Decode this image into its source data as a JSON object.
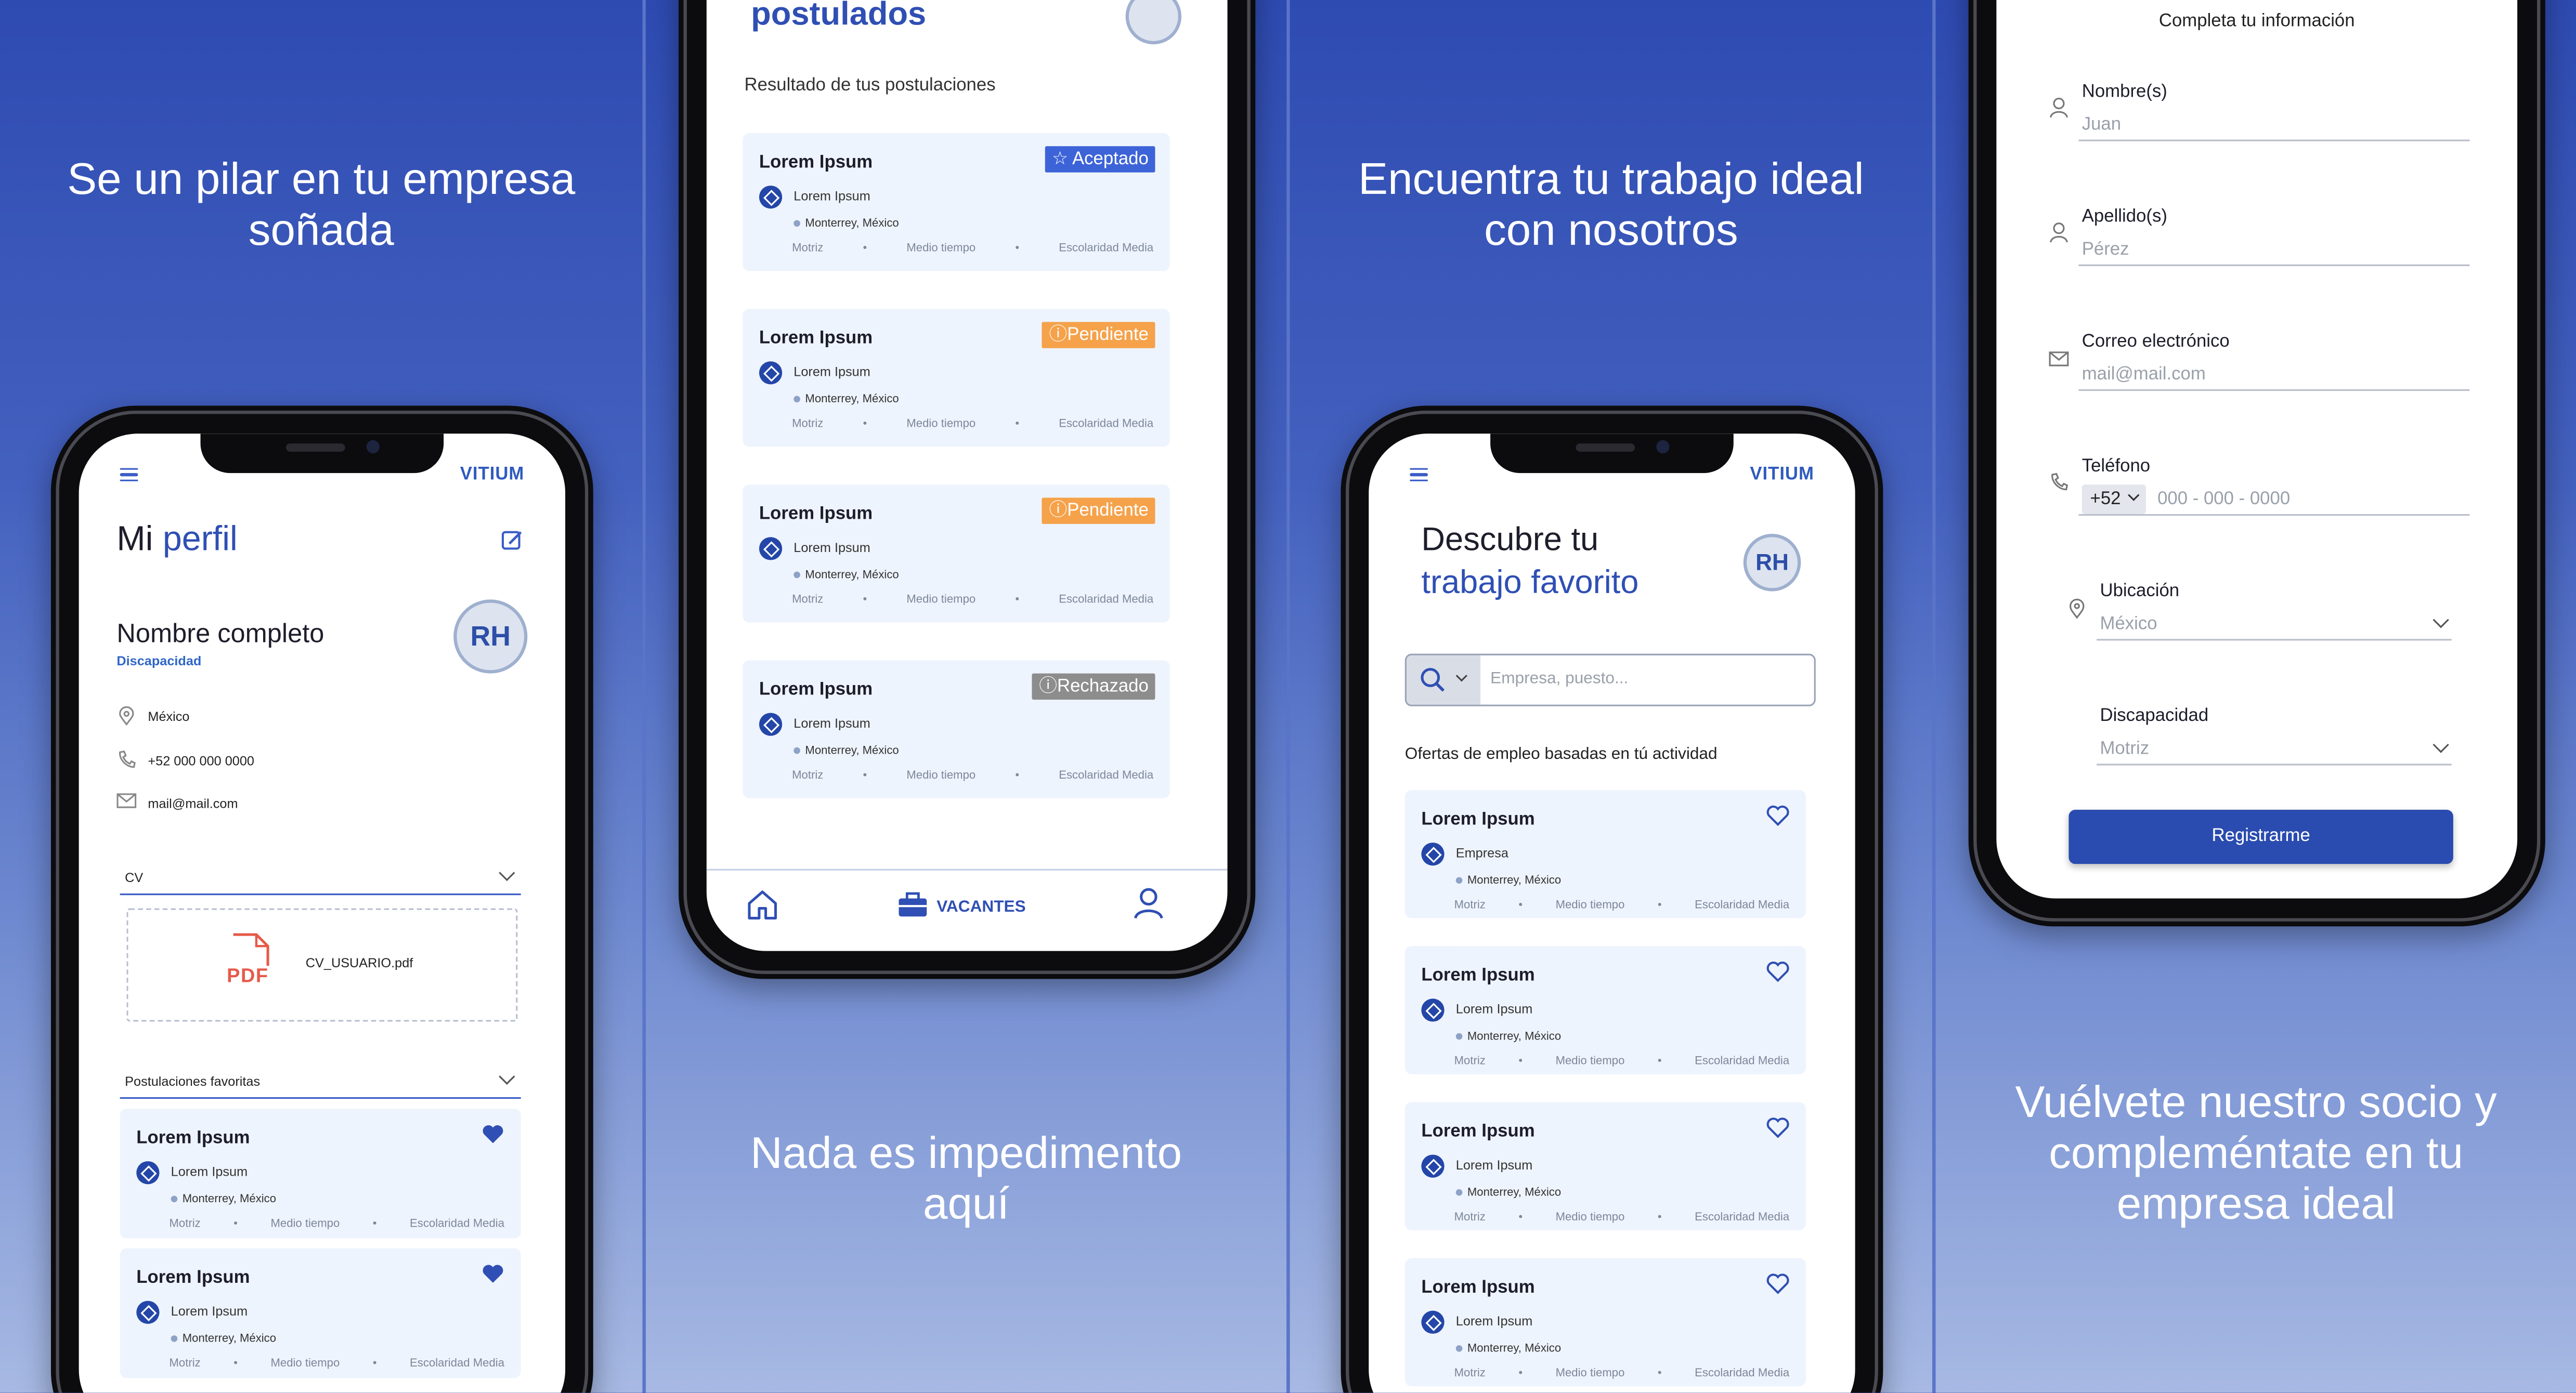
{
  "colors": {
    "primary": "#2f4fb4",
    "accepted": "#3d63d8",
    "pending": "#f5a24b",
    "rejected": "#8d8d8d",
    "card_bg": "#eef4fd",
    "panel_bg": "#3553b5"
  },
  "captions": {
    "panel1": [
      "Se un pilar en tu empresa",
      "soñada"
    ],
    "panel2": [
      "Nada es impedimento",
      "aquí"
    ],
    "panel3": [
      "Encuentra tu trabajo ideal",
      "con nosotros"
    ],
    "panel4": [
      "Vuélvete nuestro socio y",
      "compleméntate en tu",
      "empresa ideal"
    ]
  },
  "app": {
    "brand": "VITIUM"
  },
  "profile": {
    "title_prefix": "Mi",
    "title_accent": "perfil",
    "avatar": "RH",
    "name": "Nombre completo",
    "tag": "Discapacidad",
    "location": "México",
    "phone": "+52 000 000 0000",
    "email": "mail@mail.com",
    "cv_label": "CV",
    "cv_file": "CV_USUARIO.pdf",
    "pdf_text": "PDF",
    "favorites_label": "Postulaciones favoritas",
    "favorites": [
      {
        "title": "Lorem Ipsum",
        "company": "Lorem Ipsum",
        "location": "Monterrey, México",
        "type": "Motriz",
        "schedule": "Medio tiempo",
        "education": "Escolaridad Media"
      },
      {
        "title": "Lorem Ipsum",
        "company": "Lorem Ipsum",
        "location": "Monterrey, México",
        "type": "Motriz",
        "schedule": "Medio tiempo",
        "education": "Escolaridad Media"
      }
    ]
  },
  "applications": {
    "title": "postulados",
    "subtitle": "Resultado de tus postulaciones",
    "items": [
      {
        "title": "Lorem Ipsum",
        "company": "Lorem Ipsum",
        "location": "Monterrey, México",
        "type": "Motriz",
        "schedule": "Medio tiempo",
        "education": "Escolaridad Media",
        "status": "Aceptado",
        "status_icon": "star-icon"
      },
      {
        "title": "Lorem Ipsum",
        "company": "Lorem Ipsum",
        "location": "Monterrey, México",
        "type": "Motriz",
        "schedule": "Medio tiempo",
        "education": "Escolaridad Media",
        "status": "Pendiente",
        "status_icon": "clock-icon"
      },
      {
        "title": "Lorem Ipsum",
        "company": "Lorem Ipsum",
        "location": "Monterrey, México",
        "type": "Motriz",
        "schedule": "Medio tiempo",
        "education": "Escolaridad Media",
        "status": "Pendiente",
        "status_icon": "clock-icon"
      },
      {
        "title": "Lorem Ipsum",
        "company": "Lorem Ipsum",
        "location": "Monterrey, México",
        "type": "Motriz",
        "schedule": "Medio tiempo",
        "education": "Escolaridad Media",
        "status": "Rechazado",
        "status_icon": "clock-icon"
      }
    ],
    "nav": {
      "active": "VACANTES"
    }
  },
  "discover": {
    "title_line1": "Descubre tu",
    "title_line2": "trabajo favorito",
    "avatar": "RH",
    "search_placeholder": "Empresa, puesto...",
    "section": "Ofertas de empleo basadas en tú actividad",
    "items": [
      {
        "title": "Lorem Ipsum",
        "company": "Empresa",
        "location": "Monterrey, México",
        "type": "Motriz",
        "schedule": "Medio tiempo",
        "education": "Escolaridad Media"
      },
      {
        "title": "Lorem Ipsum",
        "company": "Lorem Ipsum",
        "location": "Monterrey, México",
        "type": "Motriz",
        "schedule": "Medio tiempo",
        "education": "Escolaridad Media"
      },
      {
        "title": "Lorem Ipsum",
        "company": "Lorem Ipsum",
        "location": "Monterrey, México",
        "type": "Motriz",
        "schedule": "Medio tiempo",
        "education": "Escolaridad Media"
      },
      {
        "title": "Lorem Ipsum",
        "company": "Lorem Ipsum",
        "location": "Monterrey, México",
        "type": "Motriz",
        "schedule": "Medio tiempo",
        "education": "Escolaridad Media"
      }
    ]
  },
  "register": {
    "header": "Completa tu  información",
    "fields": {
      "nombre_label": "Nombre(s)",
      "nombre_value": "Juan",
      "apellido_label": "Apellido(s)",
      "apellido_value": "Pérez",
      "correo_label": "Correo electrónico",
      "correo_value": "mail@mail.com",
      "telefono_label": "Teléfono",
      "telefono_prefix": "+52",
      "telefono_placeholder": "000 - 000 - 0000",
      "ubicacion_label": "Ubicación",
      "ubicacion_value": "México",
      "discapacidad_label": "Discapacidad",
      "discapacidad_value": "Motriz"
    },
    "submit": "Registrarme"
  }
}
